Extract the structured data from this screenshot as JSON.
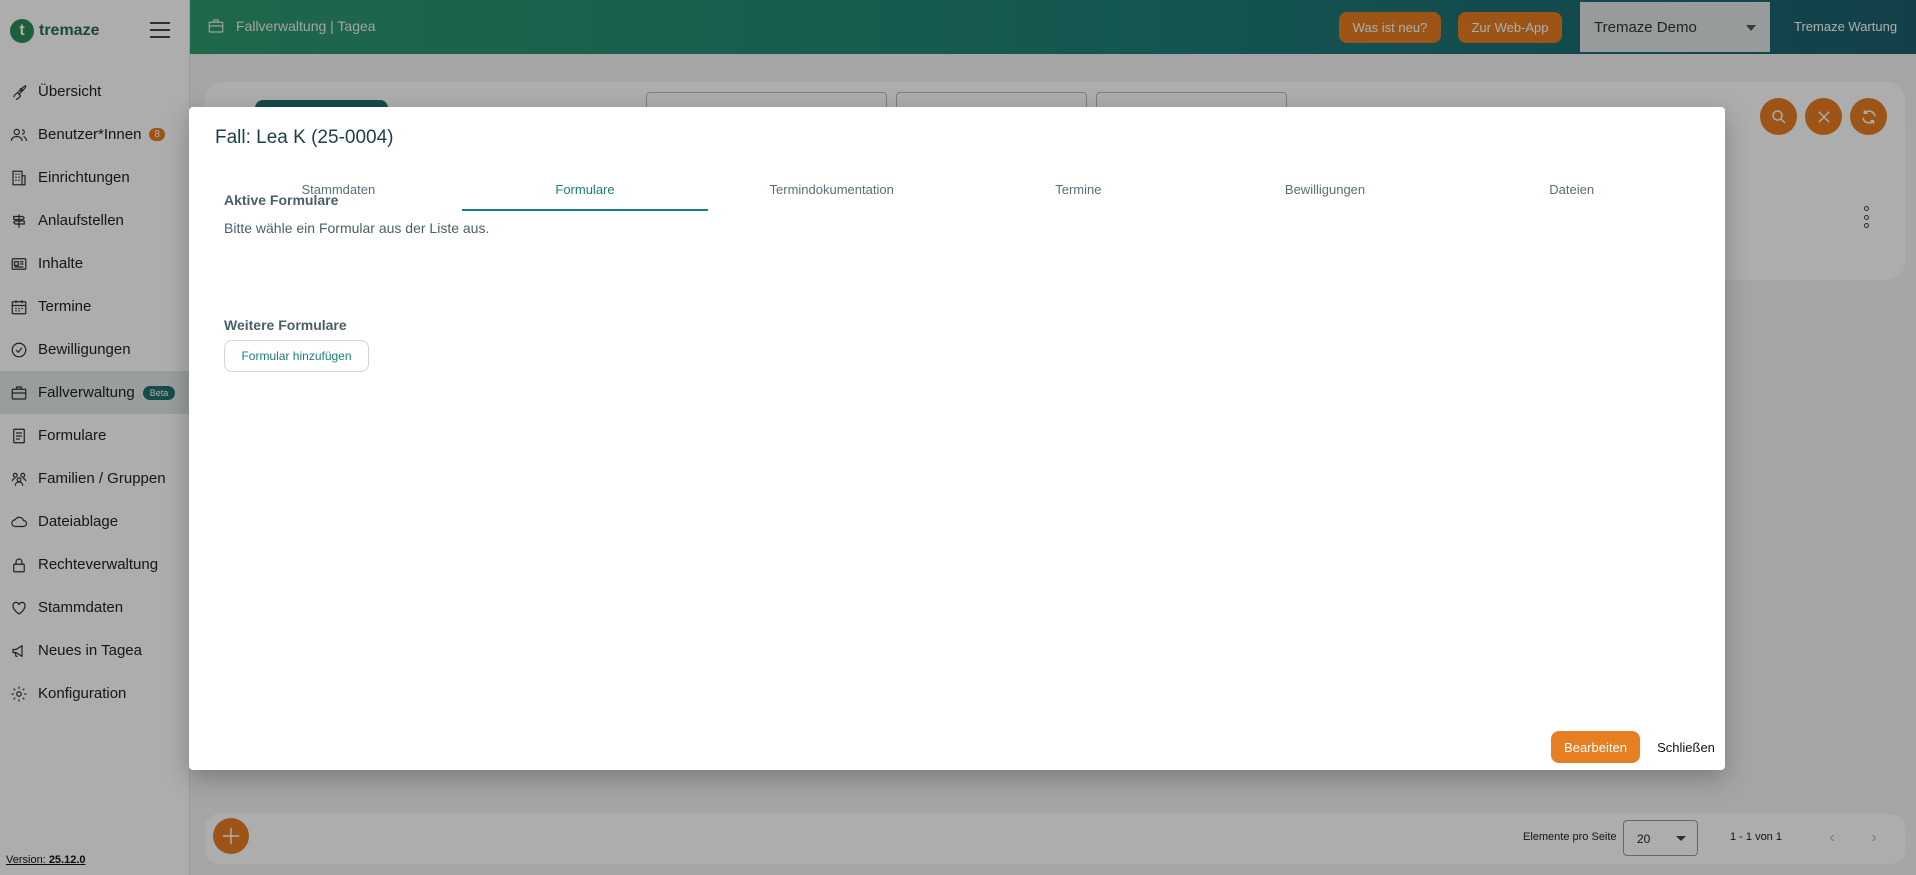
{
  "app": {
    "logo_letter": "t",
    "logo_text": "tremaze"
  },
  "sidebar": {
    "items": [
      {
        "label": "Übersicht",
        "icon": "rocket-icon"
      },
      {
        "label": "Benutzer*Innen",
        "icon": "users-icon",
        "badge": "8"
      },
      {
        "label": "Einrichtungen",
        "icon": "building-icon"
      },
      {
        "label": "Anlaufstellen",
        "icon": "signpost-icon"
      },
      {
        "label": "Inhalte",
        "icon": "newspaper-icon"
      },
      {
        "label": "Termine",
        "icon": "calendar-icon"
      },
      {
        "label": "Bewilligungen",
        "icon": "check-circle-icon"
      },
      {
        "label": "Fallverwaltung",
        "icon": "briefcase-icon",
        "badge": "Beta",
        "active": true
      },
      {
        "label": "Formulare",
        "icon": "form-icon"
      },
      {
        "label": "Familien / Gruppen",
        "icon": "group-icon"
      },
      {
        "label": "Dateiablage",
        "icon": "cloud-icon"
      },
      {
        "label": "Rechteverwaltung",
        "icon": "lock-icon"
      },
      {
        "label": "Stammdaten",
        "icon": "heart-icon"
      },
      {
        "label": "Neues in Tagea",
        "icon": "megaphone-icon"
      },
      {
        "label": "Konfiguration",
        "icon": "gear-icon"
      }
    ],
    "version_label": "Version:",
    "version_number": "25.12.0"
  },
  "topbar": {
    "title": "Fallverwaltung | Tagea",
    "whats_new": "Was ist neu?",
    "web_app": "Zur Web-App",
    "tenant": "Tremaze Demo",
    "maintenance": "Tremaze Wartung"
  },
  "pagination": {
    "per_page_label": "Elemente pro Seite",
    "per_page_value": "20",
    "range": "1 - 1 von 1"
  },
  "dialog": {
    "title": "Fall: Lea K (25-0004)",
    "tabs": [
      "Stammdaten",
      "Formulare",
      "Termindokumentation",
      "Termine",
      "Bewilligungen",
      "Dateien"
    ],
    "active_tab": 1,
    "active_forms_heading": "Aktive Formulare",
    "empty_text": "Bitte wähle ein Formular aus der Liste aus.",
    "more_forms_heading": "Weitere Formulare",
    "add_form_button": "Formular hinzufügen",
    "edit_button": "Bearbeiten",
    "close_button": "Schließen"
  },
  "colors": {
    "accent_orange": "#e67e22",
    "teal": "#1b7f78"
  }
}
